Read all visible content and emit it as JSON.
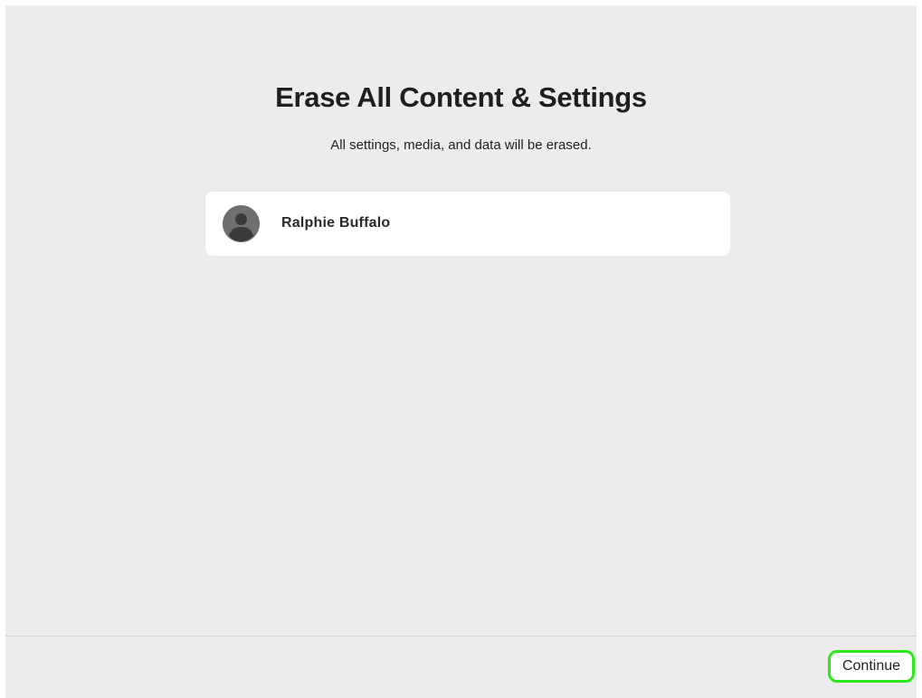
{
  "main": {
    "title": "Erase All Content & Settings",
    "subtitle": "All settings, media, and data will be erased.",
    "user": {
      "name": "Ralphie Buffalo",
      "avatar_icon": "person-silhouette-icon"
    }
  },
  "footer": {
    "continue_label": "Continue"
  },
  "colors": {
    "background": "#ececec",
    "card": "#ffffff",
    "avatar": "#6f6f6f",
    "focus_ring": "#2ee81c"
  }
}
